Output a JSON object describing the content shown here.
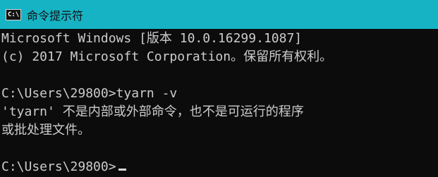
{
  "window": {
    "title": "命令提示符",
    "icon_label": "C:\\"
  },
  "console": {
    "lines": [
      "Microsoft Windows [版本 10.0.16299.1087]",
      "(c) 2017 Microsoft Corporation。保留所有权利。",
      "",
      "C:\\Users\\29800>tyarn -v",
      "'tyarn' 不是内部或外部命令，也不是可运行的程序",
      "或批处理文件。",
      "",
      "C:\\Users\\29800>"
    ]
  },
  "colors": {
    "titlebar": "#16b3c5",
    "console_bg": "#0c0c0c",
    "console_fg": "#cccccc"
  }
}
